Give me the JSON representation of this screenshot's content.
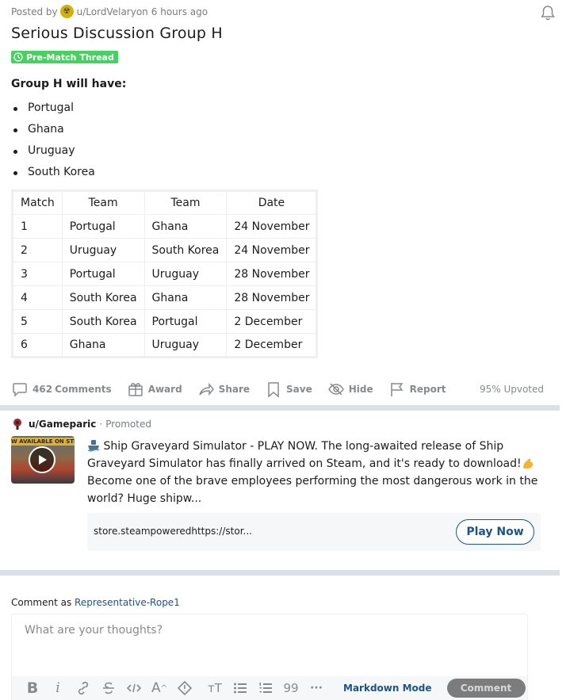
{
  "post": {
    "posted_by_prefix": "Posted by",
    "author": "u/LordVelaryon",
    "time": "6 hours ago",
    "title": "Serious Discussion Group H",
    "flair": "Pre-Match Thread",
    "body_heading": "Group H will have:",
    "teams": [
      "Portugal",
      "Ghana",
      "Uruguay",
      "South Korea"
    ],
    "table": {
      "headers": [
        "Match",
        "Team",
        "Team",
        "Date"
      ],
      "rows": [
        [
          "1",
          "Portugal",
          "Ghana",
          "24 November"
        ],
        [
          "2",
          "Uruguay",
          "South Korea",
          "24 November"
        ],
        [
          "3",
          "Portugal",
          "Uruguay",
          "28 November"
        ],
        [
          "4",
          "South Korea",
          "Ghana",
          "28 November"
        ],
        [
          "5",
          "South Korea",
          "Portugal",
          "2 December"
        ],
        [
          "6",
          "Ghana",
          "Uruguay",
          "2 December"
        ]
      ]
    },
    "actions": {
      "comments_count": "462",
      "comments_label": "Comments",
      "award": "Award",
      "share": "Share",
      "save": "Save",
      "hide": "Hide",
      "report": "Report",
      "upvoted": "95% Upvoted"
    }
  },
  "promoted": {
    "advertiser": "u/Gameparic",
    "separator": "·",
    "promoted_label": "Promoted",
    "thumbnail_banner": "W AVAILABLE ON STE",
    "text_part1": "Ship Graveyard Simulator - PLAY NOW. The long-awaited release of Ship Graveyard Simulator has finally arrived on Steam, and it's ready to download!",
    "text_part2": "Become one of the brave employees performing the most dangerous work in the world? Huge shipw...",
    "link_url": "store.steampoweredhttps://stor...",
    "cta": "Play Now"
  },
  "comment": {
    "comment_as_prefix": "Comment as",
    "username": "Representative-Rope1",
    "placeholder": "What are your thoughts?",
    "toolbar": {
      "bold": "B",
      "italic": "i",
      "superscript": "A",
      "heading": "тT",
      "code_block": "99",
      "more": "···",
      "markdown_mode": "Markdown Mode",
      "submit": "Comment"
    }
  },
  "colors": {
    "flair_bg": "#46d160",
    "divider": "#dae0e6",
    "link_blue": "#1a5488",
    "muted": "#878a8c"
  }
}
